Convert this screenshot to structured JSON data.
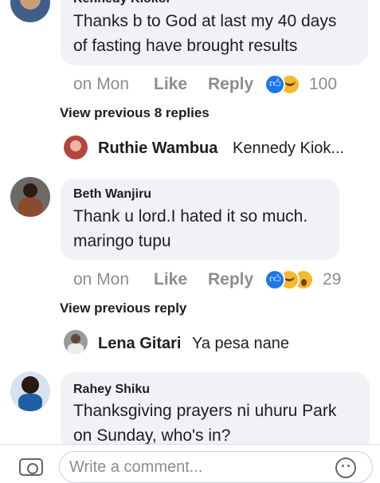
{
  "comments": [
    {
      "author": "Kennedy Kiokoi",
      "text_lines": [
        "Thanks b to God at last my 40 days",
        "of fasting have brought results"
      ],
      "time": "on Mon",
      "like_label": "Like",
      "reply_label": "Reply",
      "reaction_count": "100",
      "reactions": [
        "like-reaction",
        "haha-reaction"
      ]
    },
    {
      "author": "Beth Wanjiru",
      "text_lines": [
        "Thank u lord.I hated it so much.",
        "maringo tupu"
      ],
      "time": "on Mon",
      "like_label": "Like",
      "reply_label": "Reply",
      "reaction_count": "29",
      "reactions": [
        "like-reaction",
        "haha-reaction",
        "wow-reaction"
      ]
    },
    {
      "author": "Rahey Shiku",
      "text_lines": [
        "Thanksgiving prayers ni uhuru Park",
        "on Sunday, who's in?"
      ]
    }
  ],
  "view_previous_replies": "View previous 8 replies",
  "view_previous_reply": "View previous reply",
  "collapsed_replies": [
    {
      "author": "Ruthie Wambua",
      "text": "Kennedy Kiok..."
    },
    {
      "author": "Lena Gitari",
      "text": "Ya pesa nane"
    }
  ],
  "composer": {
    "placeholder": "Write a comment..."
  },
  "colors": {
    "bubble": "#f0f2f5",
    "meta": "#8a8d91",
    "like_blue": "#1877f2",
    "haha_yellow": "#f7b928"
  }
}
